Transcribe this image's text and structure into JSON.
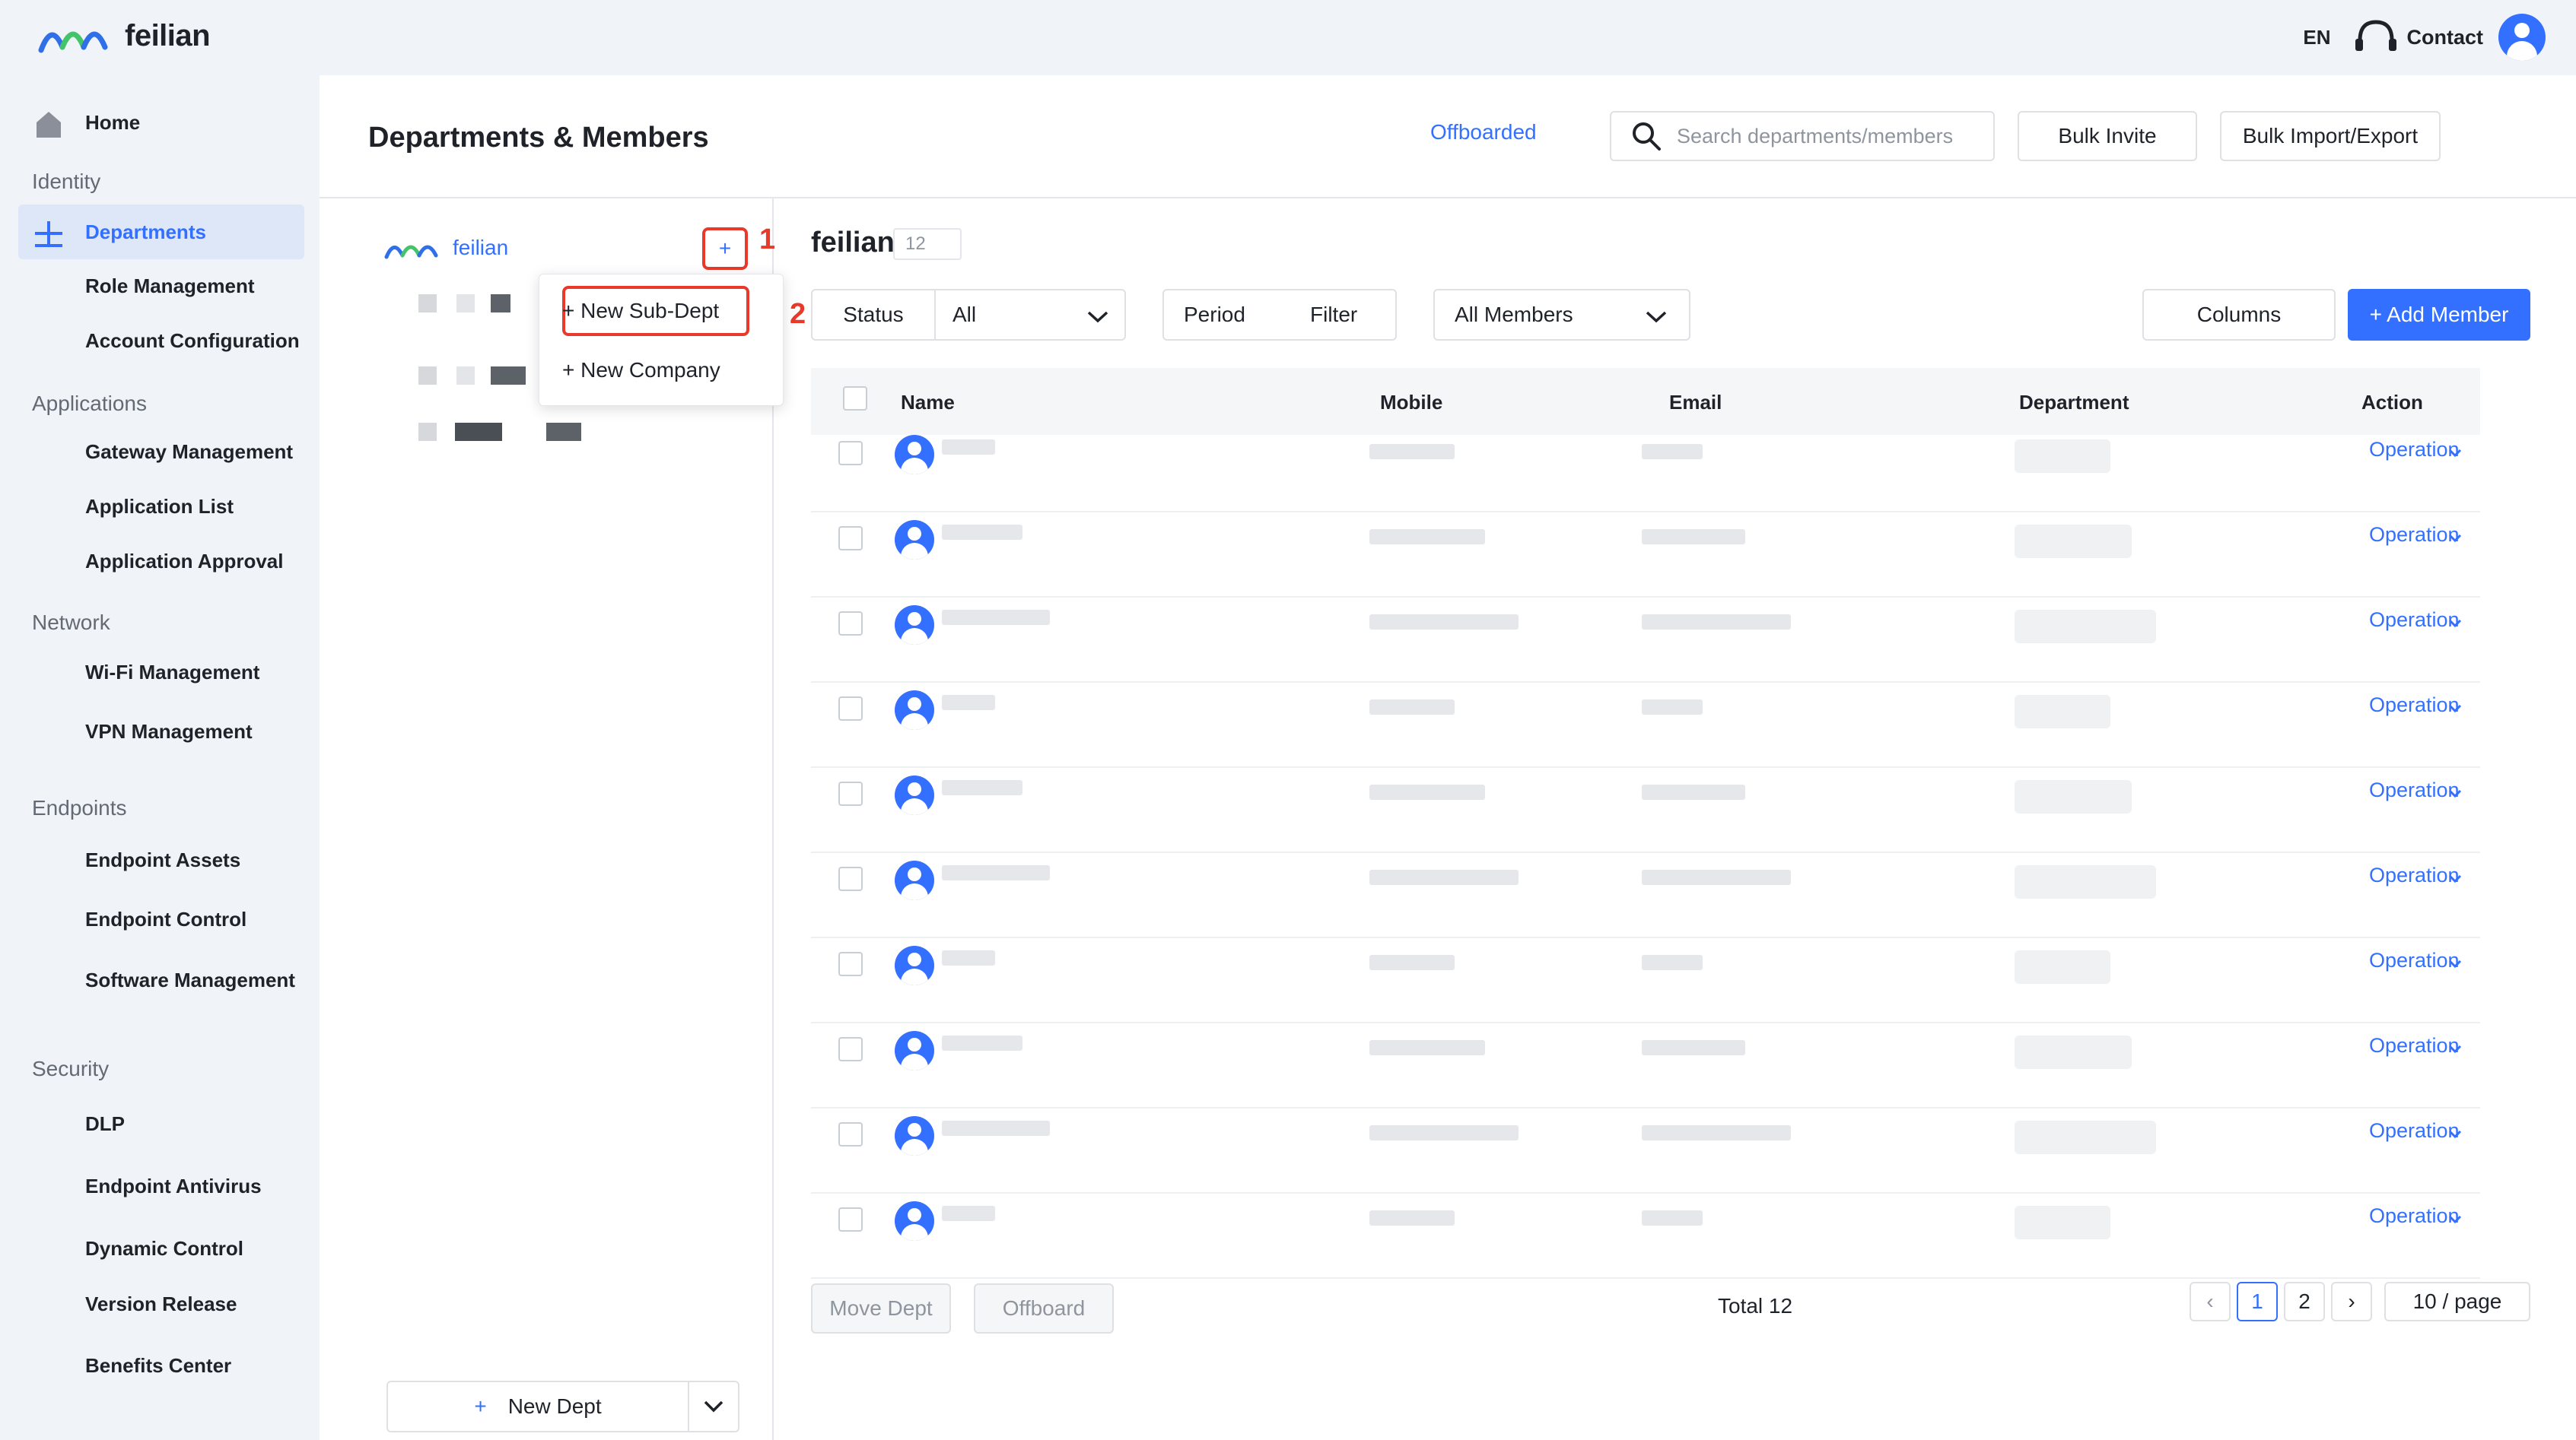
{
  "brand": {
    "name": "feilian"
  },
  "topbar": {
    "language": "EN",
    "contact_label": "Contact"
  },
  "sidebar": {
    "home": "Home",
    "groups": {
      "identity": "Identity",
      "applications": "Applications",
      "network": "Network",
      "endpoints": "Endpoints",
      "security": "Security"
    },
    "items": {
      "departments": "Departments",
      "role_management": "Role Management",
      "account_configuration": "Account Configuration",
      "gateway_management": "Gateway Management",
      "application_list": "Application List",
      "application_approval": "Application Approval",
      "wifi_management": "Wi-Fi Management",
      "vpn_management": "VPN Management",
      "endpoint_assets": "Endpoint Assets",
      "endpoint_control": "Endpoint Control",
      "software_management": "Software Management",
      "dlp": "DLP",
      "endpoint_antivirus": "Endpoint Antivirus",
      "dynamic_control": "Dynamic Control",
      "version_release": "Version Release",
      "benefits_center": "Benefits Center"
    },
    "active": "departments"
  },
  "header": {
    "title": "Departments & Members",
    "offboarded_link": "Offboarded",
    "search_placeholder": "Search departments/members",
    "bulk_invite": "Bulk Invite",
    "bulk_import_export": "Bulk Import/Export"
  },
  "tree": {
    "root_name": "feilian",
    "add_symbol": "+",
    "step1": "1",
    "step2": "2",
    "menu": {
      "new_sub_dept": "+ New Sub-Dept",
      "new_company": "+ New Company"
    },
    "new_dept_plus": "+",
    "new_dept_label": "New Dept"
  },
  "members": {
    "dept_name": "feilian",
    "count": "12",
    "filters": {
      "status_label": "Status",
      "status_value": "All",
      "period_label": "Period",
      "filter_label": "Filter",
      "members_value": "All Members",
      "columns_label": "Columns",
      "add_member": "+ Add Member"
    },
    "columns": [
      "Name",
      "Mobile",
      "Email",
      "Department",
      "Action"
    ],
    "row_action": "Operation",
    "row_count": 10
  },
  "footer": {
    "move_dept": "Move Dept",
    "offboard": "Offboard",
    "total": "Total 12",
    "prev": "‹",
    "pages": [
      "1",
      "2"
    ],
    "current_page": "1",
    "next": "›",
    "per_page": "10 / page"
  },
  "colors": {
    "accent": "#3370ff",
    "annotation_red": "#e8392b",
    "sidebar_bg": "#f0f3f8",
    "logo_blue": "#2f6fe8",
    "logo_green": "#43c46a"
  },
  "icons": {
    "home": "home-icon",
    "departments": "org-icon",
    "contact": "headset-icon",
    "user": "user-avatar-icon",
    "search": "search-icon",
    "chevron": "chevron-down-icon"
  }
}
